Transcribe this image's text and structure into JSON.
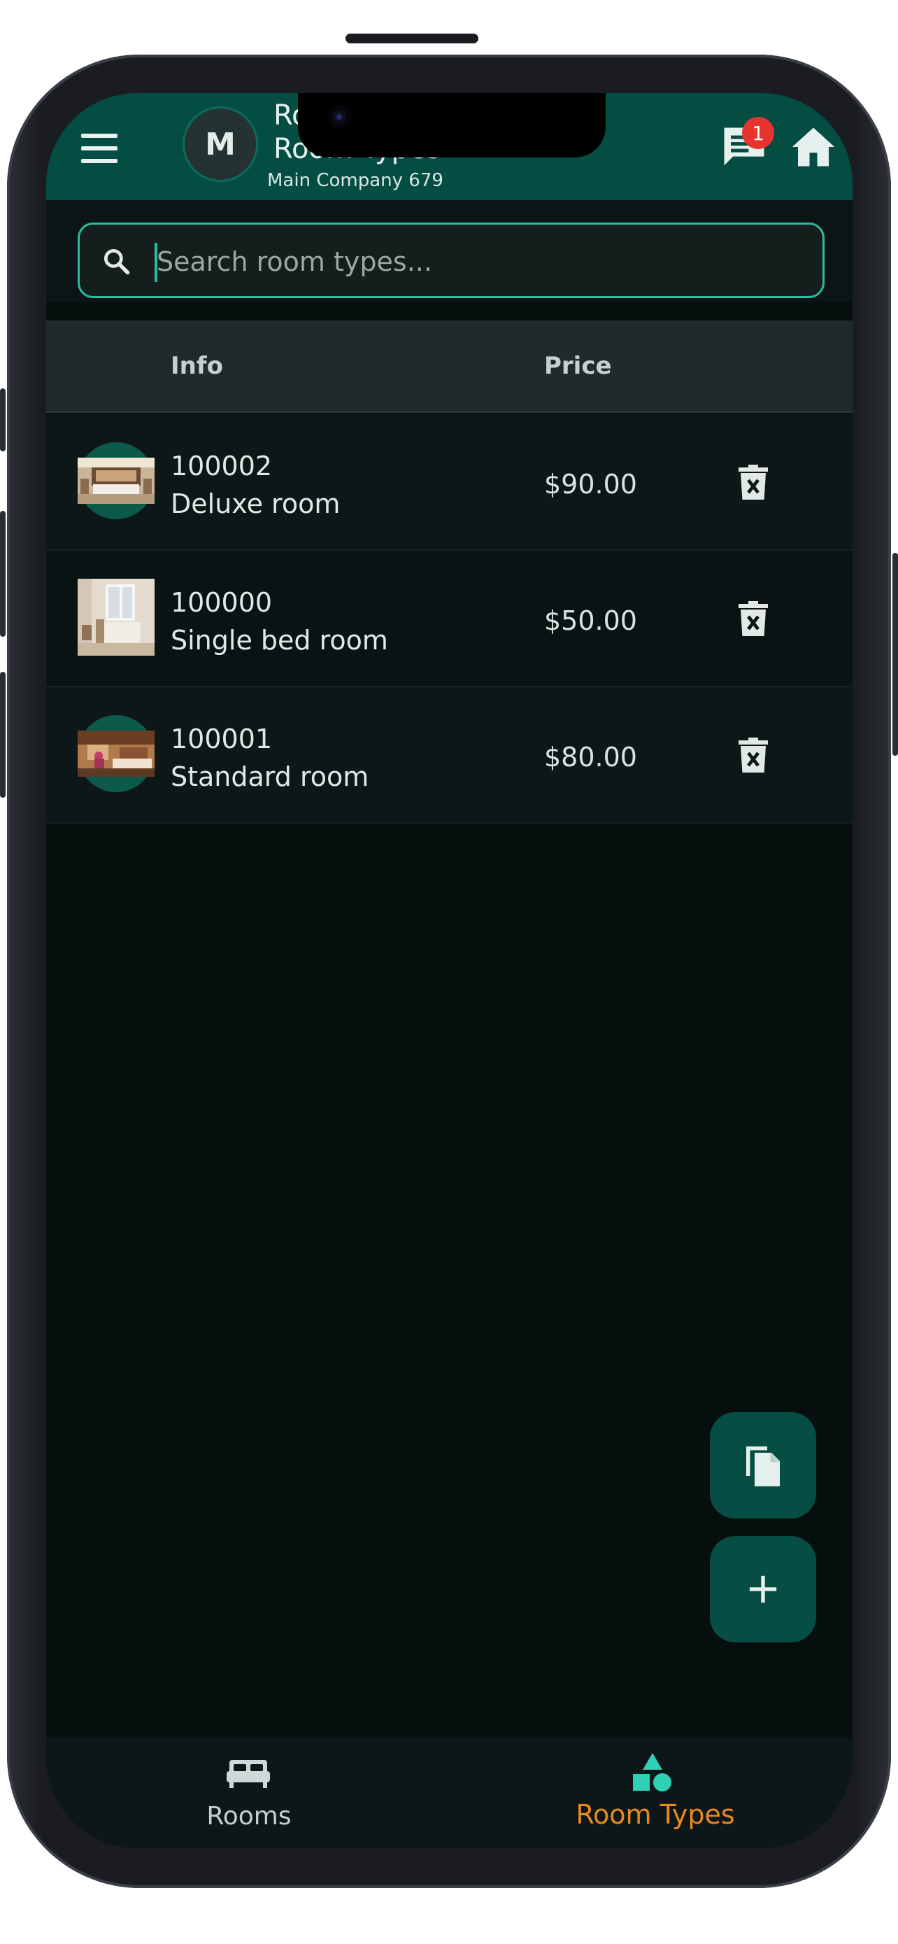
{
  "header": {
    "avatar_letter": "M",
    "title_line1": "Ro",
    "title_line2": "Room Types",
    "company": "Main Company 679",
    "notification_count": "1"
  },
  "search": {
    "placeholder": "Search room types..."
  },
  "table": {
    "columns": {
      "info": "Info",
      "price": "Price"
    },
    "rows": [
      {
        "code": "100002",
        "name": "Deluxe room",
        "price": "$90.00"
      },
      {
        "code": "100000",
        "name": "Single bed room",
        "price": "$50.00"
      },
      {
        "code": "100001",
        "name": "Standard room",
        "price": "$80.00"
      }
    ]
  },
  "bottom_nav": {
    "items": [
      {
        "label": "Rooms",
        "icon": "bed-icon",
        "active": false
      },
      {
        "label": "Room Types",
        "icon": "shapes-icon",
        "active": true
      }
    ]
  },
  "colors": {
    "header_bg": "#034d42",
    "accent": "#2bbba0",
    "active_tab": "#e8891f",
    "badge": "#e8342e",
    "screen_bg": "#060e0e"
  }
}
